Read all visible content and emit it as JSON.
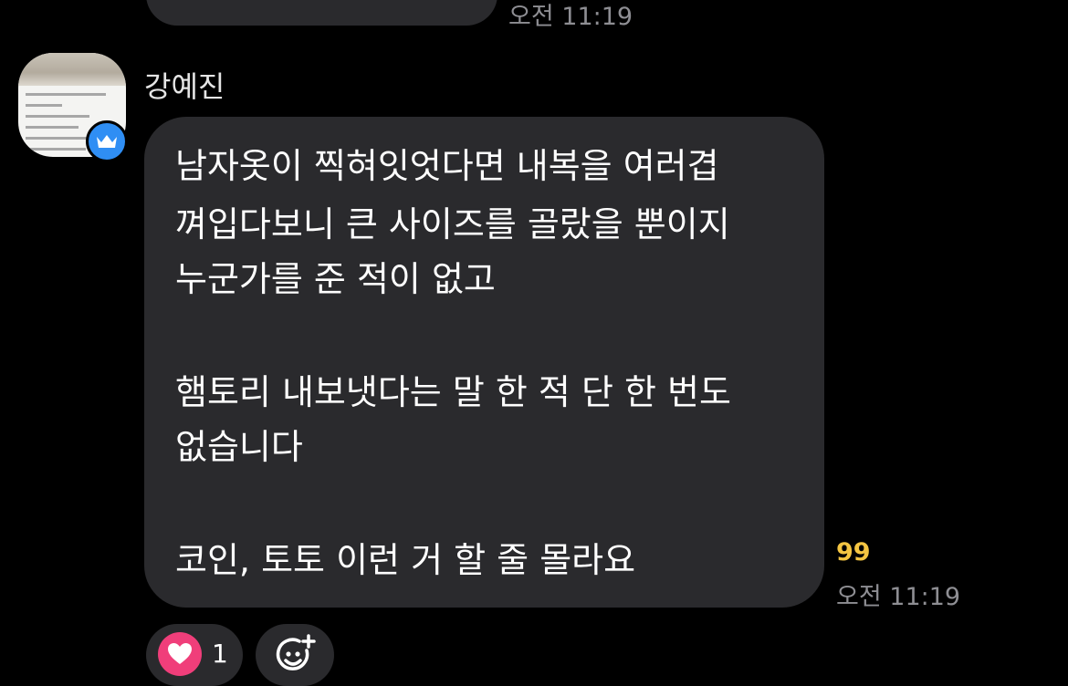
{
  "previous_message": {
    "time": "오전 11:19"
  },
  "message": {
    "sender": "강예진",
    "lines": [
      "남자옷이 찍혀잇엇다면 내복을 여러겹",
      "껴입다보니 큰 사이즈를 골랐을 뿐이지",
      "누군가를 준 적이 없고",
      "",
      "햄토리 내보냇다는 말 한 적 단 한 번도",
      "없습니다",
      "",
      "코인, 토토 이런 거 할 줄 몰라요"
    ],
    "unread_count": "99",
    "time": "오전 11:19"
  },
  "reactions": {
    "heart_count": "1"
  },
  "colors": {
    "background": "#000000",
    "bubble": "#2a2a2d",
    "unread": "#f4c542",
    "heart": "#f03e7a",
    "badge": "#2f8ef4"
  },
  "icons": {
    "badge": "crown-icon",
    "reaction": "heart-icon",
    "add_reaction": "smiley-plus-icon"
  }
}
